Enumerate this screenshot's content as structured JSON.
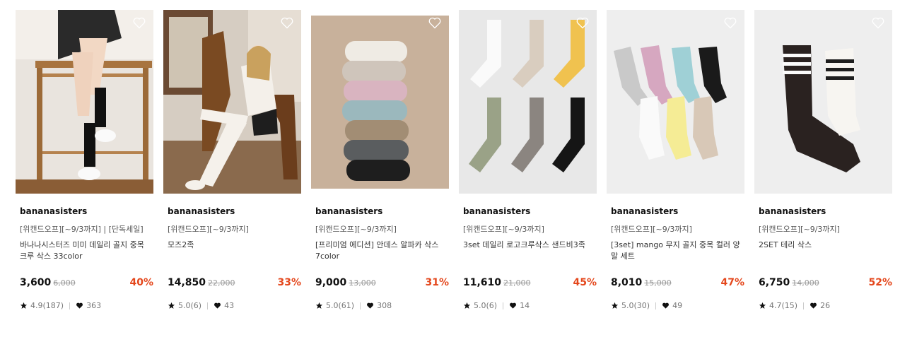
{
  "products": [
    {
      "brand": "bananasisters",
      "tag": "[위캔드오프][~9/3까지] | [단독세일]",
      "name": "바나나시스터즈 미미 데일리 골지 중목 크루 삭스 33color",
      "price": "3,600",
      "original_price": "6,000",
      "discount": "40%",
      "rating": "4.9(187)",
      "likes": "363"
    },
    {
      "brand": "bananasisters",
      "tag": "[위캔드오프][~9/3까지]",
      "name": "모즈2족",
      "price": "14,850",
      "original_price": "22,000",
      "discount": "33%",
      "rating": "5.0(6)",
      "likes": "43"
    },
    {
      "brand": "bananasisters",
      "tag": "[위캔드오프][~9/3까지]",
      "name": "[프리미엄 에디션] 안데스 알파카 삭스 7color",
      "price": "9,000",
      "original_price": "13,000",
      "discount": "31%",
      "rating": "5.0(61)",
      "likes": "308"
    },
    {
      "brand": "bananasisters",
      "tag": "[위캔드오프][~9/3까지]",
      "name": "3set 데일리 로고크루삭스 샌드비3족",
      "price": "11,610",
      "original_price": "21,000",
      "discount": "45%",
      "rating": "5.0(6)",
      "likes": "14"
    },
    {
      "brand": "bananasisters",
      "tag": "[위캔드오프][~9/3까지]",
      "name": "[3set] mango 무지 골지 중목 컬러 양말 세트",
      "price": "8,010",
      "original_price": "15,000",
      "discount": "47%",
      "rating": "5.0(30)",
      "likes": "49"
    },
    {
      "brand": "bananasisters",
      "tag": "[위캔드오프][~9/3까지]",
      "name": "2SET 테리 삭스",
      "price": "6,750",
      "original_price": "14,000",
      "discount": "52%",
      "rating": "4.7(15)",
      "likes": "26"
    }
  ],
  "icons": {
    "wishlist": "heart-outline-icon",
    "rating": "star-icon",
    "likes": "heart-filled-icon"
  },
  "colors": {
    "discount": "#e4471c"
  }
}
